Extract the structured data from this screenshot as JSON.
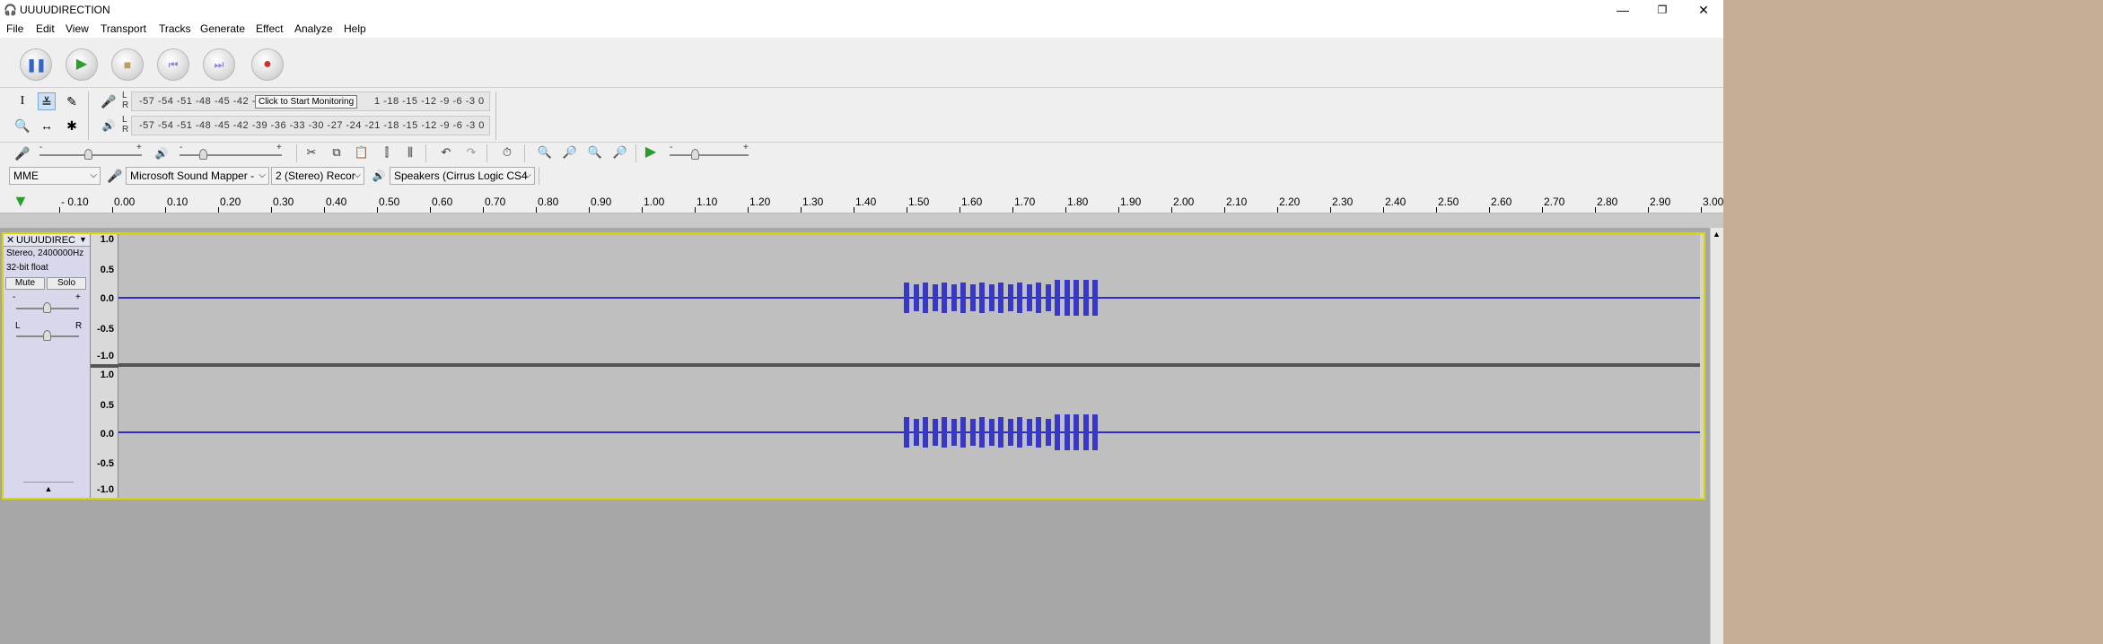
{
  "window": {
    "title": "UUUUDIRECTION",
    "minimize": "—",
    "restore": "❐",
    "close": "✕"
  },
  "menu": [
    "File",
    "Edit",
    "View",
    "Transport",
    "Tracks",
    "Generate",
    "Effect",
    "Analyze",
    "Help"
  ],
  "transport": {
    "pause": "pause-icon",
    "play": "play-icon",
    "stop": "stop-icon",
    "skip_start": "skip-start-icon",
    "skip_end": "skip-end-icon",
    "record": "record-icon"
  },
  "meters": {
    "record_ticks": "-57 -54 -51 -48 -45 -42 -",
    "record_ticks_right": "1 -18 -15 -12  -9  -6  -3  0",
    "playback_ticks": "-57 -54 -51 -48 -45 -42 -39 -36 -33 -30 -27 -24 -21 -18 -15 -12  -9  -6  -3  0",
    "tooltip": "Click to Start Monitoring",
    "L": "L",
    "R": "R"
  },
  "devices": {
    "host": "MME",
    "recording_device": "Microsoft Sound Mapper - ",
    "channels": "2 (Stereo) Recor",
    "playback_device": "Speakers (Cirrus Logic CS4"
  },
  "ruler": {
    "labels": [
      "- 0.10",
      "0.00",
      "0.10",
      "0.20",
      "0.30",
      "0.40",
      "0.50",
      "0.60",
      "0.70",
      "0.80",
      "0.90",
      "1.00",
      "1.10",
      "1.20",
      "1.30",
      "1.40",
      "1.50",
      "1.60",
      "1.70",
      "1.80",
      "1.90",
      "2.00",
      "2.10",
      "2.20",
      "2.30",
      "2.40",
      "2.50",
      "2.60",
      "2.70",
      "2.80",
      "2.90",
      "3.00"
    ]
  },
  "track": {
    "name": "UUUUDIREC",
    "close": "✕",
    "menu_arrow": "▼",
    "info1": "Stereo, 2400000Hz",
    "info2": "32-bit float",
    "mute": "Mute",
    "solo": "Solo",
    "gain_minus": "-",
    "gain_plus": "+",
    "pan_L": "L",
    "pan_R": "R",
    "collapse": "▲",
    "scale": [
      "1.0",
      "0.5",
      "0.0",
      "-0.5",
      "-1.0"
    ]
  },
  "slider_minus": "-",
  "slider_plus": "+"
}
